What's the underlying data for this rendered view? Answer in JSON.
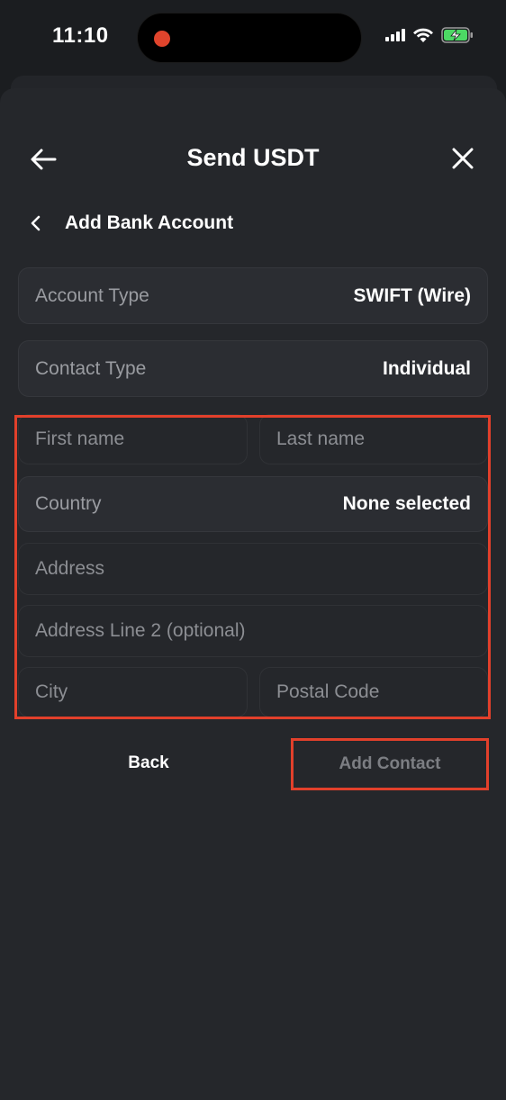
{
  "status": {
    "time": "11:10"
  },
  "header": {
    "title": "Send USDT"
  },
  "subheader": {
    "title": "Add Bank Account"
  },
  "form": {
    "account_type": {
      "label": "Account Type",
      "value": "SWIFT (Wire)"
    },
    "contact_type": {
      "label": "Contact Type",
      "value": "Individual"
    },
    "first_name": {
      "placeholder": "First name"
    },
    "last_name": {
      "placeholder": "Last name"
    },
    "country": {
      "label": "Country",
      "value": "None selected"
    },
    "address": {
      "placeholder": "Address"
    },
    "address2": {
      "placeholder": "Address Line 2 (optional)"
    },
    "city": {
      "placeholder": "City"
    },
    "postal_code": {
      "placeholder": "Postal Code"
    }
  },
  "actions": {
    "back_label": "Back",
    "add_label": "Add Contact"
  },
  "colors": {
    "background": "#1b1d20",
    "sheet": "#25272b",
    "highlight": "#e2402b",
    "recording": "#e0442c",
    "battery": "#4cd964"
  },
  "icons": [
    "back-arrow-icon",
    "close-icon",
    "chevron-left-icon",
    "signal-icon",
    "wifi-icon",
    "battery-charging-icon"
  ]
}
